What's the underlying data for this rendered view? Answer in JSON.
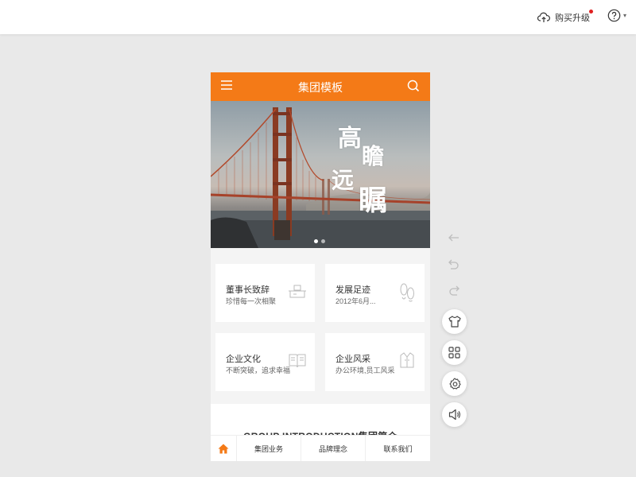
{
  "topbar": {
    "upgrade_label": "购买升级",
    "help_caret": "▾"
  },
  "phone": {
    "header_title": "集团模板",
    "banner": {
      "hero_chars": [
        "高",
        "瞻",
        "远",
        "瞩"
      ],
      "active_slide": 1,
      "slide_count": 2
    },
    "cards": [
      {
        "title": "董事长致辞",
        "desc": "珍惜每一次相聚",
        "icon": "desk-icon"
      },
      {
        "title": "发展足迹",
        "desc": "2012年6月...",
        "icon": "footprint-icon"
      },
      {
        "title": "企业文化",
        "desc": "不断突破，追求幸福",
        "icon": "book-icon"
      },
      {
        "title": "企业风采",
        "desc": "办公环境,员工风采",
        "icon": "shirt-icon"
      }
    ],
    "intro_text": "GROUP INTRODUCTION集团简介",
    "tabs": [
      {
        "label": "集团业务"
      },
      {
        "label": "品牌理念"
      },
      {
        "label": "联系我们"
      }
    ]
  },
  "colors": {
    "accent": "#f47a17",
    "badge": "#e02020"
  }
}
